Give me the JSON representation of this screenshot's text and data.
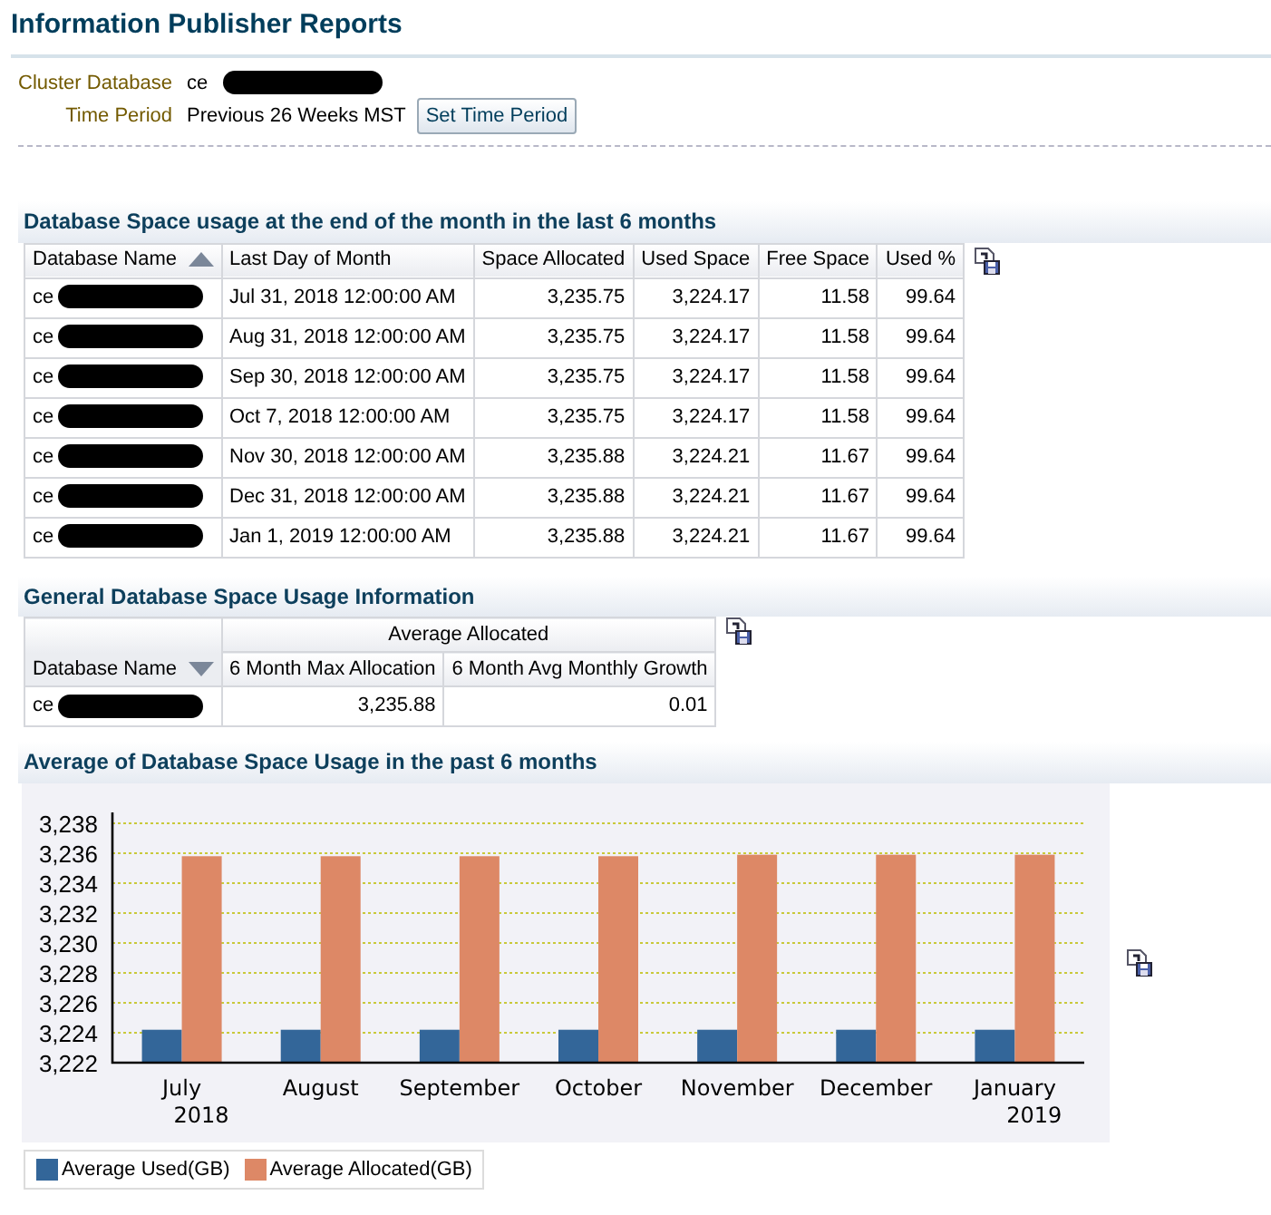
{
  "page_title": "Information Publisher Reports",
  "filters": [
    {
      "label": "Cluster Database",
      "value": "ce",
      "redacted": true
    },
    {
      "label": "Time Period",
      "value": "Previous 26 Weeks MST",
      "button": "Set Time Period"
    }
  ],
  "monthly_usage": {
    "title": "Database Space usage at the end of the month in the last 6 months",
    "columns": [
      {
        "label": "Database Name",
        "sort_ascending": true
      },
      {
        "label": "Last Day of Month"
      },
      {
        "label": "Space Allocated"
      },
      {
        "label": "Used Space"
      },
      {
        "label": "Free Space"
      },
      {
        "label": "Used %"
      }
    ],
    "rows": [
      {
        "redacted": true,
        "cells": [
          "ce",
          "Jul 31, 2018 12:00:00 AM",
          "3,235.75",
          "3,224.17",
          "11.58",
          "99.64"
        ]
      },
      {
        "redacted": true,
        "cells": [
          "ce",
          "Aug 31, 2018 12:00:00 AM",
          "3,235.75",
          "3,224.17",
          "11.58",
          "99.64"
        ]
      },
      {
        "redacted": true,
        "cells": [
          "ce",
          "Sep 30, 2018 12:00:00 AM",
          "3,235.75",
          "3,224.17",
          "11.58",
          "99.64"
        ]
      },
      {
        "redacted": true,
        "cells": [
          "ce",
          "Oct 7, 2018 12:00:00 AM",
          "3,235.75",
          "3,224.17",
          "11.58",
          "99.64"
        ]
      },
      {
        "redacted": true,
        "cells": [
          "ce",
          "Nov 30, 2018 12:00:00 AM",
          "3,235.88",
          "3,224.21",
          "11.67",
          "99.64"
        ]
      },
      {
        "redacted": true,
        "cells": [
          "ce",
          "Dec 31, 2018 12:00:00 AM",
          "3,235.88",
          "3,224.21",
          "11.67",
          "99.64"
        ]
      },
      {
        "redacted": true,
        "cells": [
          "ce",
          "Jan 1, 2019 12:00:00 AM",
          "3,235.88",
          "3,224.21",
          "11.67",
          "99.64"
        ]
      }
    ]
  },
  "general_usage": {
    "title": "General Database Space Usage Information",
    "group_header": "Average Allocated",
    "columns": [
      {
        "label": "Database Name",
        "sort_ascending": false
      },
      {
        "label": "6 Month Max Allocation"
      },
      {
        "label": "6 Month Avg Monthly Growth"
      }
    ],
    "rows": [
      {
        "redacted": true,
        "cells": [
          "ce",
          "3,235.88",
          "0.01"
        ]
      }
    ]
  },
  "average_chart": {
    "title": "Average of Database Space Usage in the past 6 months",
    "chart_data": {
      "type": "bar",
      "grid": true,
      "categories": [
        "July\n2018",
        "August",
        "September",
        "October",
        "November",
        "December",
        "January\n2019"
      ],
      "series": [
        {
          "name": "Average Used(GB)",
          "color": "#336699",
          "values": [
            3224.2,
            3224.2,
            3224.2,
            3224.2,
            3224.2,
            3224.2,
            3224.2
          ]
        },
        {
          "name": "Average Allocated(GB)",
          "color": "#dd8866",
          "values": [
            3235.8,
            3235.8,
            3235.8,
            3235.8,
            3235.9,
            3235.9,
            3235.9
          ]
        }
      ],
      "ylim": [
        3222,
        3238
      ],
      "yticks": [
        {
          "value": 3222,
          "label": "3,222"
        },
        {
          "value": 3224,
          "label": "3,224"
        },
        {
          "value": 3226,
          "label": "3,226"
        },
        {
          "value": 3228,
          "label": "3,228"
        },
        {
          "value": 3230,
          "label": "3,230"
        },
        {
          "value": 3232,
          "label": "3,232"
        },
        {
          "value": 3234,
          "label": "3,234"
        },
        {
          "value": 3236,
          "label": "3,236"
        },
        {
          "value": 3238,
          "label": "3,238"
        }
      ]
    }
  }
}
